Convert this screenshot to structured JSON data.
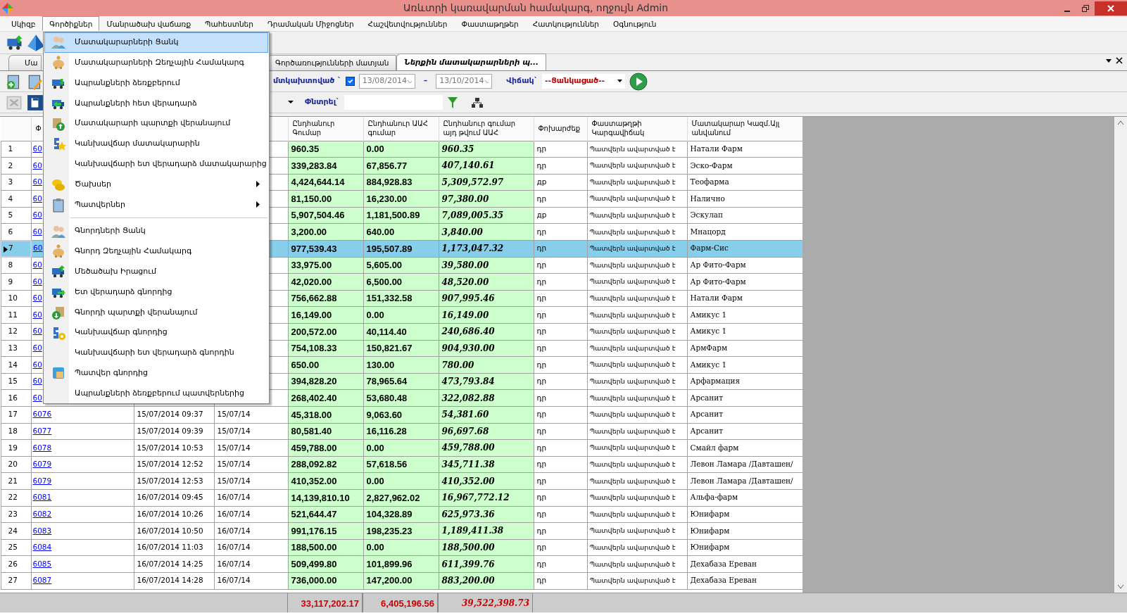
{
  "window": {
    "title": "Առևտրի կառավարման համակարգ, ողջույն Admin"
  },
  "menubar": [
    {
      "label": "Սկիզբ",
      "selected": false
    },
    {
      "label": "Գործիքներ",
      "selected": true
    },
    {
      "label": "Մանրածախ վաճառք",
      "selected": false
    },
    {
      "label": "Պահեստներ",
      "selected": false
    },
    {
      "label": "Դրամական Միջոցներ",
      "selected": false
    },
    {
      "label": "Հաշվետվություններ",
      "selected": false
    },
    {
      "label": "Փաստաթղթեր",
      "selected": false
    },
    {
      "label": "Հատկություններ",
      "selected": false
    },
    {
      "label": "Օգնություն",
      "selected": false
    }
  ],
  "dropdown_menu": [
    {
      "label": "Մատակարարների Ցանկ",
      "selected": true,
      "submenu": false
    },
    {
      "label": "Մատակարարների Զեղչային Համակարգ",
      "selected": false,
      "submenu": false
    },
    {
      "label": "Ապրանքների ձեռքբերում",
      "selected": false,
      "submenu": false
    },
    {
      "label": "Ապրանքների հետ վերադարձ",
      "selected": false,
      "submenu": false
    },
    {
      "label": "Մատակարարի պարտքի վերանայում",
      "selected": false,
      "submenu": false
    },
    {
      "label": "Կանխավճար մատակարարին",
      "selected": false,
      "submenu": false
    },
    {
      "label": "Կանխավճարի ետ վերադարձ մատակարարից",
      "selected": false,
      "submenu": false
    },
    {
      "label": "Ծախսեր",
      "selected": false,
      "submenu": true
    },
    {
      "label": "Պատվերներ",
      "selected": false,
      "submenu": true
    },
    {
      "kind": "separator"
    },
    {
      "label": "Գնորդների Ցանկ",
      "selected": false,
      "submenu": false
    },
    {
      "label": "Գնորդ Զեղչային Համակարգ",
      "selected": false,
      "submenu": false
    },
    {
      "label": "Մեծածախ Իրացում",
      "selected": false,
      "submenu": false
    },
    {
      "label": "Ետ վերադարձ գնորդից",
      "selected": false,
      "submenu": false
    },
    {
      "label": "Գնորդի պարտքի վերանայում",
      "selected": false,
      "submenu": false
    },
    {
      "label": "Կանխավճար գնորդից",
      "selected": false,
      "submenu": false
    },
    {
      "label": "Կանխավճարի ետ վերադարձ գնորդին",
      "selected": false,
      "submenu": false
    },
    {
      "label": "Պատվեր գնորդից",
      "selected": false,
      "submenu": false
    },
    {
      "label": "Ապրանքների ձեռքբերում պատվերներից",
      "selected": false,
      "submenu": false
    }
  ],
  "tabs": [
    {
      "label": "Մա",
      "selected": false
    },
    {
      "label": "Գործառությունների մատյան",
      "selected": false
    },
    {
      "label": "Ներքին մատակարարների պ...",
      "selected": true
    }
  ],
  "filters": {
    "date_label": "մտկախտոված `",
    "date_enabled": true,
    "date_from": "13/08/2014",
    "date_to": "13/10/2014",
    "range_dash": "–",
    "state_label": "Վիճակ`",
    "state_value": "--Ցանկացած--",
    "search_label": "Փնտրել`"
  },
  "table": {
    "columns": {
      "doc": "Փ",
      "total": "Ընդհանուր Գումար",
      "vat": "Ընդհանուր ԱԱՀ գումար",
      "sum": "Ընդհանուր գումար այդ թվում ԱԱՀ",
      "currency": "Փոխարժեք",
      "status": "Փաստաթղթի Կարգավիճակ",
      "supplier": "Մատակարար Կազմ.Այլ անվանում"
    },
    "rows": [
      {
        "n": "1",
        "doc": "60",
        "total": "960.35",
        "vat": "0.00",
        "sum": "960.35",
        "currency": "դր",
        "status": "Պատվերն ավարտված է",
        "supplier": "Натали Фарм",
        "selected": false
      },
      {
        "n": "2",
        "doc": "60",
        "total": "339,283.84",
        "vat": "67,856.77",
        "sum": "407,140.61",
        "currency": "դր",
        "status": "Պատվերն ավարտված է",
        "supplier": "Эско-Фарм",
        "selected": false
      },
      {
        "n": "3",
        "doc": "60",
        "total": "4,424,644.14",
        "vat": "884,928.83",
        "sum": "5,309,572.97",
        "currency": "др",
        "status": "Պատվերն ավարտված է",
        "supplier": "Теофарма",
        "selected": false
      },
      {
        "n": "4",
        "doc": "60",
        "total": "81,150.00",
        "vat": "16,230.00",
        "sum": "97,380.00",
        "currency": "դր",
        "status": "Պատվերն ավարտված է",
        "supplier": "Налично",
        "selected": false
      },
      {
        "n": "5",
        "doc": "60",
        "total": "5,907,504.46",
        "vat": "1,181,500.89",
        "sum": "7,089,005.35",
        "currency": "др",
        "status": "Պատվերն ավարտված է",
        "supplier": "Эскулап",
        "selected": false
      },
      {
        "n": "6",
        "doc": "60",
        "total": "3,200.00",
        "vat": "640.00",
        "sum": "3,840.00",
        "currency": "դր",
        "status": "Պատվերն ավարտված է",
        "supplier": "Мнацорд",
        "selected": false
      },
      {
        "n": "7",
        "doc": "60",
        "total": "977,539.43",
        "vat": "195,507.89",
        "sum": "1,173,047.32",
        "currency": "դր",
        "status": "Պատվերն ավարտված է",
        "supplier": "Фарм-Сис",
        "selected": true
      },
      {
        "n": "8",
        "doc": "60",
        "total": "33,975.00",
        "vat": "5,605.00",
        "sum": "39,580.00",
        "currency": "դր",
        "status": "Պատվերն ավարտված է",
        "supplier": "Ар Фито-Фарм",
        "selected": false
      },
      {
        "n": "9",
        "doc": "60",
        "total": "42,020.00",
        "vat": "6,500.00",
        "sum": "48,520.00",
        "currency": "դր",
        "status": "Պատվերն ավարտված է",
        "supplier": "Ар Фито-Фарм",
        "selected": false
      },
      {
        "n": "10",
        "doc": "60",
        "total": "756,662.88",
        "vat": "151,332.58",
        "sum": "907,995.46",
        "currency": "դր",
        "status": "Պատվերն ավարտված է",
        "supplier": "Натали Фарм",
        "selected": false
      },
      {
        "n": "11",
        "doc": "60",
        "total": "16,149.00",
        "vat": "0.00",
        "sum": "16,149.00",
        "currency": "դր",
        "status": "Պատվերն ավարտված է",
        "supplier": "Амикус 1",
        "selected": false
      },
      {
        "n": "12",
        "doc": "60",
        "total": "200,572.00",
        "vat": "40,114.40",
        "sum": "240,686.40",
        "currency": "դր",
        "status": "Պատվերն ավարտված է",
        "supplier": "Амикус 1",
        "selected": false
      },
      {
        "n": "13",
        "doc": "60",
        "total": "754,108.33",
        "vat": "150,821.67",
        "sum": "904,930.00",
        "currency": "դր",
        "status": "Պատվերն ավարտված է",
        "supplier": "АрмФарм",
        "selected": false
      },
      {
        "n": "14",
        "doc": "60",
        "total": "650.00",
        "vat": "130.00",
        "sum": "780.00",
        "currency": "դր",
        "status": "Պատվերն ավարտված է",
        "supplier": "Амикус 1",
        "selected": false
      },
      {
        "n": "15",
        "doc": "60",
        "total": "394,828.20",
        "vat": "78,965.64",
        "sum": "473,793.84",
        "currency": "դր",
        "status": "Պատվերն ավարտված է",
        "supplier": "Арфармация",
        "selected": false
      },
      {
        "n": "16",
        "doc": "60",
        "total": "268,402.40",
        "vat": "53,680.48",
        "sum": "322,082.88",
        "currency": "դր",
        "status": "Պատվերն ավարտված է",
        "supplier": "Арсанит",
        "selected": false
      },
      {
        "n": "17",
        "doc": "6076",
        "datetime": "15/07/2014 09:37",
        "date": "15/07/14",
        "total": "45,318.00",
        "vat": "9,063.60",
        "sum": "54,381.60",
        "currency": "դր",
        "status": "Պատվերն ավարտված է",
        "supplier": "Арсанит",
        "selected": false
      },
      {
        "n": "18",
        "doc": "6077",
        "datetime": "15/07/2014 09:39",
        "date": "15/07/14",
        "total": "80,581.40",
        "vat": "16,116.28",
        "sum": "96,697.68",
        "currency": "դր",
        "status": "Պատվերն ավարտված է",
        "supplier": "Арсанит",
        "selected": false
      },
      {
        "n": "19",
        "doc": "6078",
        "datetime": "15/07/2014 10:53",
        "date": "15/07/14",
        "total": "459,788.00",
        "vat": "0.00",
        "sum": "459,788.00",
        "currency": "դր",
        "status": "Պատվերն ավարտված է",
        "supplier": "Смайл фарм",
        "selected": false
      },
      {
        "n": "20",
        "doc": "6079",
        "datetime": "15/07/2014 12:52",
        "date": "15/07/14",
        "total": "288,092.82",
        "vat": "57,618.56",
        "sum": "345,711.38",
        "currency": "դր",
        "status": "Պատվերն ավարտված է",
        "supplier": "Левон Ламара /Давташен/",
        "selected": false
      },
      {
        "n": "21",
        "doc": "6079",
        "datetime": "15/07/2014 12:53",
        "date": "15/07/14",
        "total": "410,352.00",
        "vat": "0.00",
        "sum": "410,352.00",
        "currency": "դր",
        "status": "Պատվերն ավարտված է",
        "supplier": "Левон Ламара /Давташен/",
        "selected": false
      },
      {
        "n": "22",
        "doc": "6081",
        "datetime": "16/07/2014 09:45",
        "date": "16/07/14",
        "total": "14,139,810.10",
        "vat": "2,827,962.02",
        "sum": "16,967,772.12",
        "currency": "դր",
        "status": "Պատվերն ավարտված է",
        "supplier": "Альфа-фарм",
        "selected": false
      },
      {
        "n": "23",
        "doc": "6082",
        "datetime": "16/07/2014 10:26",
        "date": "16/07/14",
        "total": "521,644.47",
        "vat": "104,328.89",
        "sum": "625,973.36",
        "currency": "դր",
        "status": "Պատվերն ավարտված է",
        "supplier": "Юнифарм",
        "selected": false
      },
      {
        "n": "24",
        "doc": "6083",
        "datetime": "16/07/2014 10:50",
        "date": "16/07/14",
        "total": "991,176.15",
        "vat": "198,235.23",
        "sum": "1,189,411.38",
        "currency": "դր",
        "status": "Պատվերն ավարտված է",
        "supplier": "Юнифарм",
        "selected": false
      },
      {
        "n": "25",
        "doc": "6084",
        "datetime": "16/07/2014 11:03",
        "date": "16/07/14",
        "total": "188,500.00",
        "vat": "0.00",
        "sum": "188,500.00",
        "currency": "դր",
        "status": "Պատվերն ավարտված է",
        "supplier": "Юнифарм",
        "selected": false
      },
      {
        "n": "26",
        "doc": "6085",
        "datetime": "16/07/2014 14:25",
        "date": "16/07/14",
        "total": "509,499.80",
        "vat": "101,899.96",
        "sum": "611,399.76",
        "currency": "դր",
        "status": "Պատվերն ավարտված է",
        "supplier": "Дехабаза Ереван",
        "selected": false
      },
      {
        "n": "27",
        "doc": "6087",
        "datetime": "16/07/2014 14:28",
        "date": "16/07/14",
        "total": "736,000.00",
        "vat": "147,200.00",
        "sum": "883,200.00",
        "currency": "դր",
        "status": "Պատվերն ավարտված է",
        "supplier": "Дехабаза Ереван",
        "selected": false
      }
    ],
    "totals": {
      "total": "33,117,202.17",
      "vat": "6,405,196.56",
      "sum": "39,522,398.73"
    }
  }
}
